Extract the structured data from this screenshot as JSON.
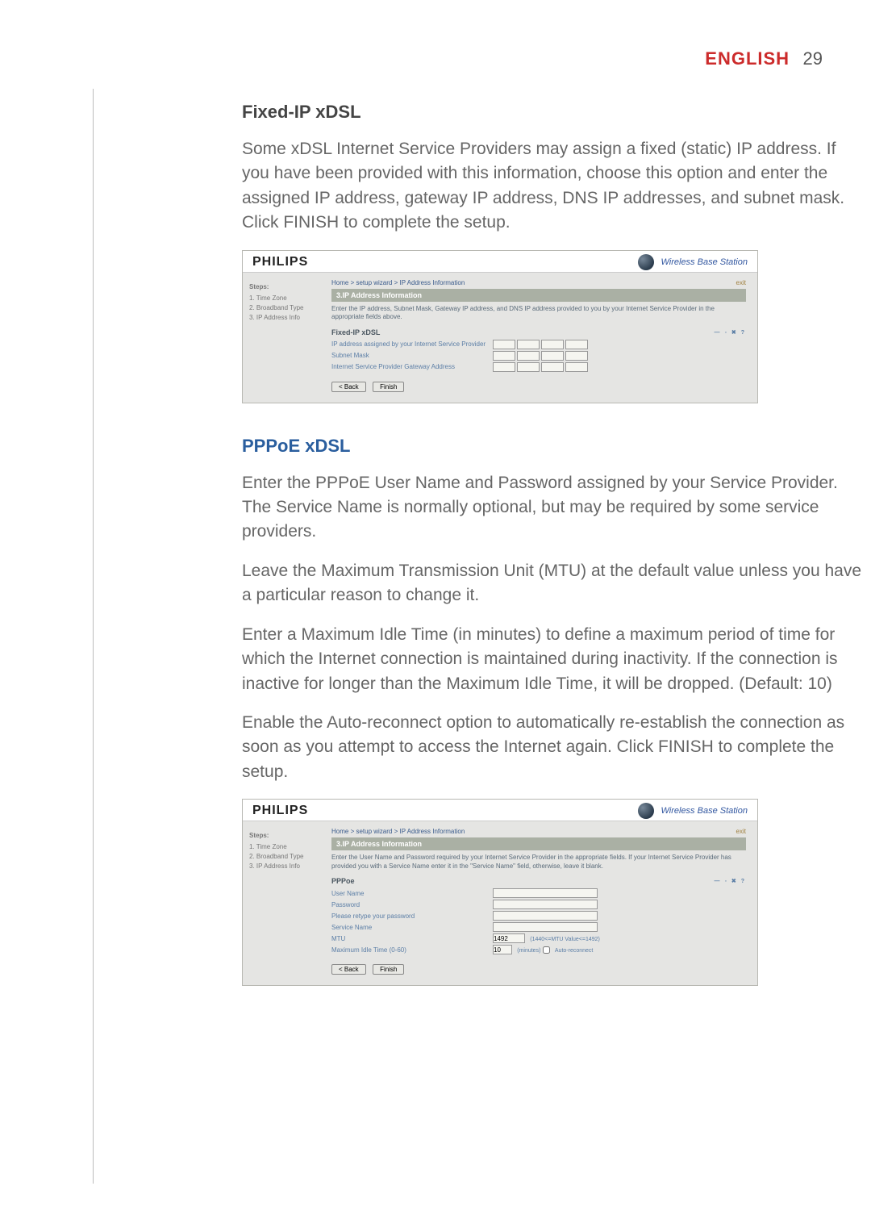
{
  "header": {
    "language": "ENGLISH",
    "page_number": "29"
  },
  "fixed_ip": {
    "title": "Fixed-IP xDSL",
    "para": "Some xDSL Internet Service Providers may assign a fixed (static) IP address. If you have been provided with this information, choose this option and enter the assigned IP address, gateway IP address, DNS IP addresses, and subnet mask. Click FINISH to complete the setup."
  },
  "shot1": {
    "brand": "PHILIPS",
    "tag": "Wireless Base Station",
    "steps_heading": "Steps:",
    "steps": [
      "1. Time Zone",
      "2. Broadband Type",
      "3. IP Address Info"
    ],
    "crumb": "Home > setup wizard > IP Address Information",
    "corner": "exit",
    "title": "3.IP Address Information",
    "desc": "Enter the IP address, Subnet Mask, Gateway IP address, and DNS IP address provided to you by your Internet Service Provider in the appropriate fields above.",
    "sub": "Fixed-IP xDSL",
    "rows": {
      "ip": "IP address assigned by your Internet Service Provider",
      "subnet": "Subnet Mask",
      "gateway": "Internet Service Provider Gateway Address"
    },
    "back": "< Back",
    "finish": "Finish"
  },
  "pppoe": {
    "title": "PPPoE xDSL",
    "p1": "Enter the PPPoE User Name and Password assigned by your Service Provider. The Service Name is normally optional, but may be required by some service providers.",
    "p2": "Leave the Maximum Transmission Unit (MTU) at the default value unless you have a particular reason to change it.",
    "p3": "Enter a Maximum Idle Time (in minutes) to define a maximum period of time for which the Internet connection is maintained during inactivity. If the connection is inactive for longer than the Maximum Idle Time, it will be dropped. (Default: 10)",
    "p4": "Enable the Auto-reconnect option to automatically re-establish the connection as soon as you attempt to access the Internet again. Click FINISH to complete the setup."
  },
  "shot2": {
    "brand": "PHILIPS",
    "tag": "Wireless Base Station",
    "steps_heading": "Steps:",
    "steps": [
      "1. Time Zone",
      "2. Broadband Type",
      "3. IP Address Info"
    ],
    "crumb": "Home > setup wizard > IP Address Information",
    "corner": "exit",
    "title": "3.IP Address Information",
    "desc": "Enter the User Name and Password required by your Internet Service Provider in the appropriate fields. If your Internet Service Provider has provided you with a Service Name enter it in the \"Service Name\" field, otherwise, leave it blank.",
    "sub": "PPPoe",
    "rows": {
      "user": "User Name",
      "pass": "Password",
      "pass2": "Please retype your password",
      "service": "Service Name",
      "mtu": "MTU",
      "mtu_val": "1492",
      "mtu_hint": "(1440<=MTU Value<=1492)",
      "idle": "Maximum Idle Time (0-60)",
      "idle_val": "10",
      "idle_unit": "(minutes)",
      "auto": "Auto-reconnect"
    },
    "back": "< Back",
    "finish": "Finish"
  }
}
